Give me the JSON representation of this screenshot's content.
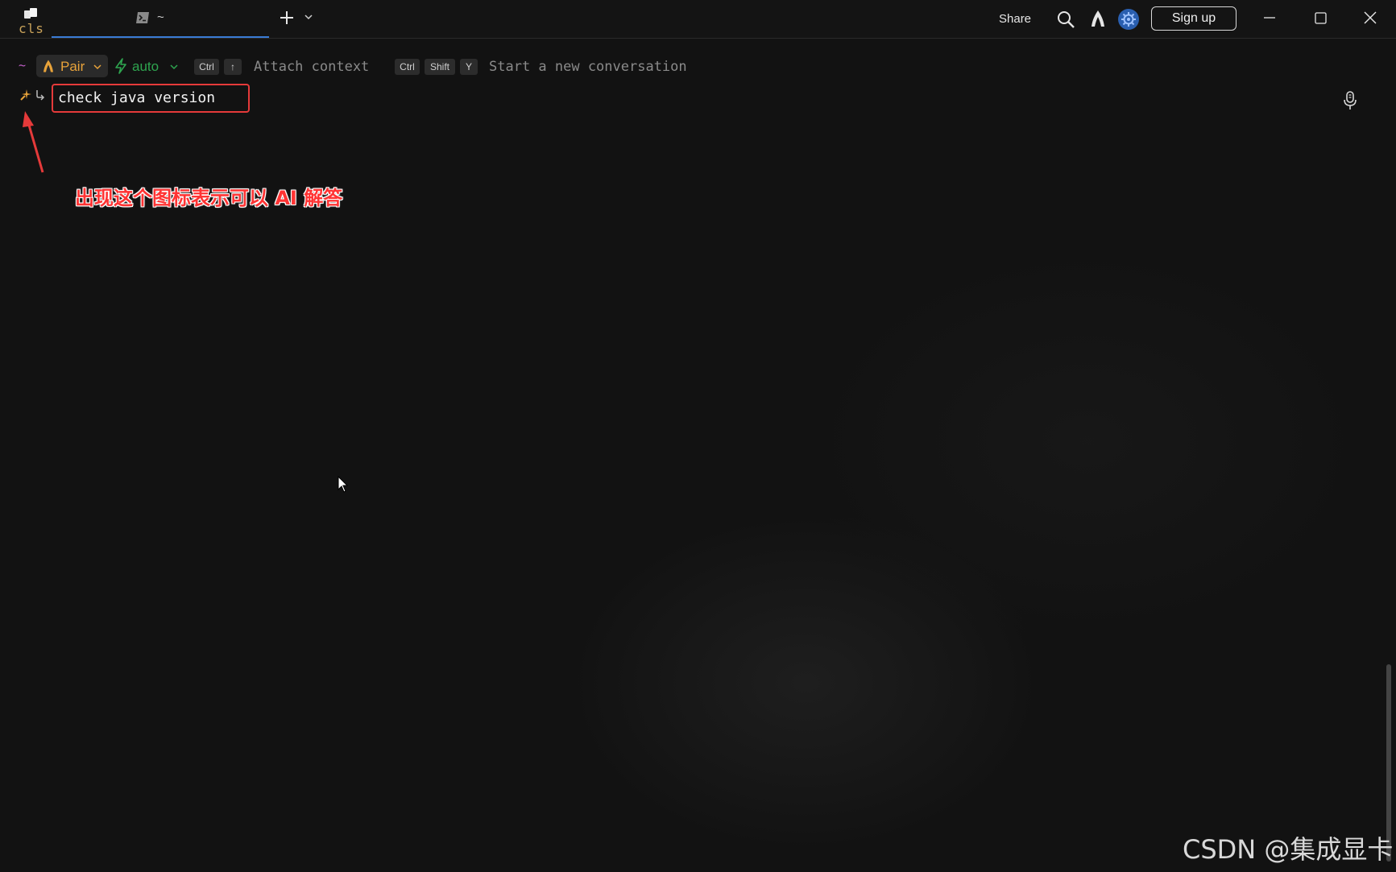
{
  "titlebar": {
    "logo_text": "cls",
    "tab_label": "~",
    "share_label": "Share",
    "signup_label": "Sign up"
  },
  "toolbar": {
    "cwd": "~",
    "mode_label": "Pair",
    "model_label": "auto",
    "attach_keys": [
      "Ctrl",
      "↑"
    ],
    "attach_hint": "Attach context",
    "new_conv_keys": [
      "Ctrl",
      "Shift",
      "Y"
    ],
    "new_conv_hint": "Start a new conversation"
  },
  "input": {
    "command": "check java version"
  },
  "annotation": {
    "text": "出现这个图标表示可以 AI 解答"
  },
  "watermark": "CSDN @集成显卡",
  "icons": [
    "app-logo-icon",
    "terminal-icon",
    "plus-icon",
    "chevron-down-icon",
    "search-icon",
    "warp-icon",
    "settings-icon",
    "minimize-icon",
    "maximize-icon",
    "close-icon",
    "pair-icon",
    "lightning-icon",
    "ai-spark-icon",
    "return-arrow-icon",
    "microphone-icon"
  ],
  "colors": {
    "background": "#111111",
    "accent_tab": "#3a7bd5",
    "pair_orange": "#e8a33a",
    "auto_green": "#2ea44f",
    "annotation_red": "#ff3333",
    "settings_blue": "#2a5fb0"
  }
}
